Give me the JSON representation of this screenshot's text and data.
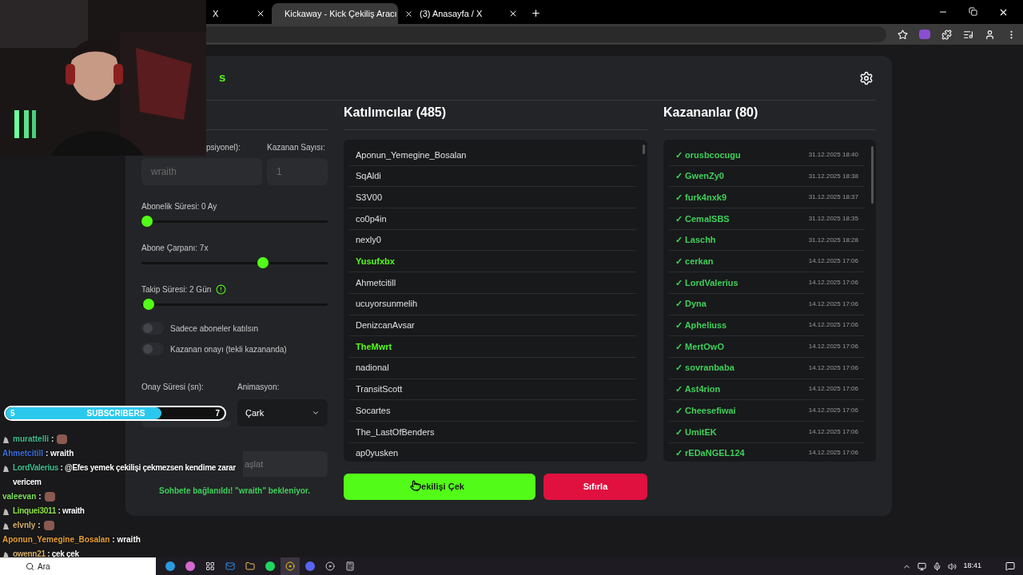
{
  "browser": {
    "tabs": [
      {
        "title": "X",
        "selected": false
      },
      {
        "title": "Kickaway - Kick Çekiliş Aracı",
        "selected": true
      },
      {
        "title": "(3) Anasayfa / X",
        "selected": false
      }
    ]
  },
  "app": {
    "title": "s",
    "settings": {
      "username_label": "psiyonel):",
      "username_placeholder": "wraith",
      "count_label": "Kazanan Sayısı:",
      "count_placeholder": "1",
      "sliders": [
        {
          "label": "Abonelik Süresi: 0 Ay",
          "level": 0,
          "info": false
        },
        {
          "label": "Abone Çarpanı: 7x",
          "level": 0.66,
          "info": false
        },
        {
          "label": "Takip Süresi: 2 Gün",
          "level": 0.01,
          "info": true
        }
      ],
      "toggles": [
        {
          "label": "Sadece aboneler katılsın",
          "on": false
        },
        {
          "label": "Kazanan onayı (tekli kazananda)",
          "on": false
        }
      ],
      "confirm_label": "Onay Süresi (sn):",
      "animation_label": "Animasyon:",
      "animation_value": "Çark",
      "start_button": "aşlat",
      "status": "Sohbete bağlanıldı! \"wraith\" bekleniyor."
    },
    "participants": {
      "title": "Katılımcılar (485)",
      "items": [
        {
          "name": "Aponun_Yemegine_Bosalan",
          "highlighted": false
        },
        {
          "name": "SqAldi",
          "highlighted": false
        },
        {
          "name": "S3V00",
          "highlighted": false
        },
        {
          "name": "co0p4in",
          "highlighted": false
        },
        {
          "name": "nexly0",
          "highlighted": false
        },
        {
          "name": "Yusufxbx",
          "highlighted": true
        },
        {
          "name": "Ahmetcitill",
          "highlighted": false
        },
        {
          "name": "ucuyorsunmelih",
          "highlighted": false
        },
        {
          "name": "DenizcanAvsar",
          "highlighted": false
        },
        {
          "name": "TheMwrt",
          "highlighted": true
        },
        {
          "name": "nadional",
          "highlighted": false
        },
        {
          "name": "TransitScott",
          "highlighted": false
        },
        {
          "name": "Socartes",
          "highlighted": false
        },
        {
          "name": "The_LastOfBenders",
          "highlighted": false
        },
        {
          "name": "ap0yusken",
          "highlighted": false
        }
      ]
    },
    "winners": {
      "title": "Kazananlar (80)",
      "items": [
        {
          "mark": "✓",
          "name": "orusbcocugu",
          "time": "31.12.2025 18:40"
        },
        {
          "mark": "✓",
          "name": "GwenZy0",
          "time": "31.12.2025 18:38"
        },
        {
          "mark": "✓",
          "name": "furk4nxk9",
          "time": "31.12.2025 18:37"
        },
        {
          "mark": "✓",
          "name": "CemalSBS",
          "time": "31.12.2025 18:35"
        },
        {
          "mark": "✓",
          "name": "Laschh",
          "time": "31.12.2025 18:28"
        },
        {
          "mark": "✓",
          "name": "cerkan",
          "time": "14.12.2025 17:06"
        },
        {
          "mark": "✓",
          "name": "LordValerius",
          "time": "14.12.2025 17:06"
        },
        {
          "mark": "✓",
          "name": "Dyna",
          "time": "14.12.2025 17:06"
        },
        {
          "mark": "✓",
          "name": "Apheliuss",
          "time": "14.12.2025 17:06"
        },
        {
          "mark": "✓",
          "name": "MertOwO",
          "time": "14.12.2025 17:06"
        },
        {
          "mark": "✓",
          "name": "sovranbaba",
          "time": "14.12.2025 17:06"
        },
        {
          "mark": "✓",
          "name": "Ast4rion",
          "time": "14.12.2025 17:06"
        },
        {
          "mark": "✓",
          "name": "Cheesefiwai",
          "time": "14.12.2025 17:06"
        },
        {
          "mark": "✓",
          "name": "UmitEK",
          "time": "14.12.2025 17:06"
        },
        {
          "mark": "✓",
          "name": "rEDaNGEL124",
          "time": "14.12.2025 17:06"
        }
      ]
    },
    "draw_button": "ekilişi Çek",
    "reset_button": "Sıfırla"
  },
  "overlay": {
    "subscribers": {
      "current": "5",
      "label": "SUBSCRIBERS",
      "goal": "7",
      "level": 0.71
    },
    "chat": [
      {
        "badge": true,
        "user": "murattelli",
        "sep": ":",
        "color": "#3fbf8f",
        "kind": "emote"
      },
      {
        "badge": false,
        "user": "Ahmetcitill",
        "sep": ":",
        "color": "#3a6fd8",
        "kind": "text",
        "text": "wraith"
      },
      {
        "badge": true,
        "user": "LordValerius",
        "sep": ":",
        "color": "#3fbf8f",
        "kind": "text",
        "text": "@Efes yemek çekilişi çekmezsen kendime zarar vericem"
      },
      {
        "badge": false,
        "user": "valeevan",
        "sep": ":",
        "color": "#7ee05a",
        "kind": "emote"
      },
      {
        "badge": true,
        "user": "Linquei3011",
        "sep": ":",
        "color": "#8fe04a",
        "kind": "text",
        "text": "wraith"
      },
      {
        "badge": true,
        "user": "elvnly",
        "sep": ":",
        "color": "#d8b070",
        "kind": "emote"
      },
      {
        "badge": false,
        "user": "Aponun_Yemegine_Bosalan",
        "sep": ":",
        "color": "#e8a030",
        "kind": "text",
        "text": "wraith"
      },
      {
        "badge": true,
        "user": "owenn21",
        "sep": ":",
        "color": "#d8b070",
        "kind": "text",
        "text": "çek çek"
      }
    ]
  },
  "taskbar": {
    "search_placeholder": "Ara",
    "time": "18:41"
  }
}
